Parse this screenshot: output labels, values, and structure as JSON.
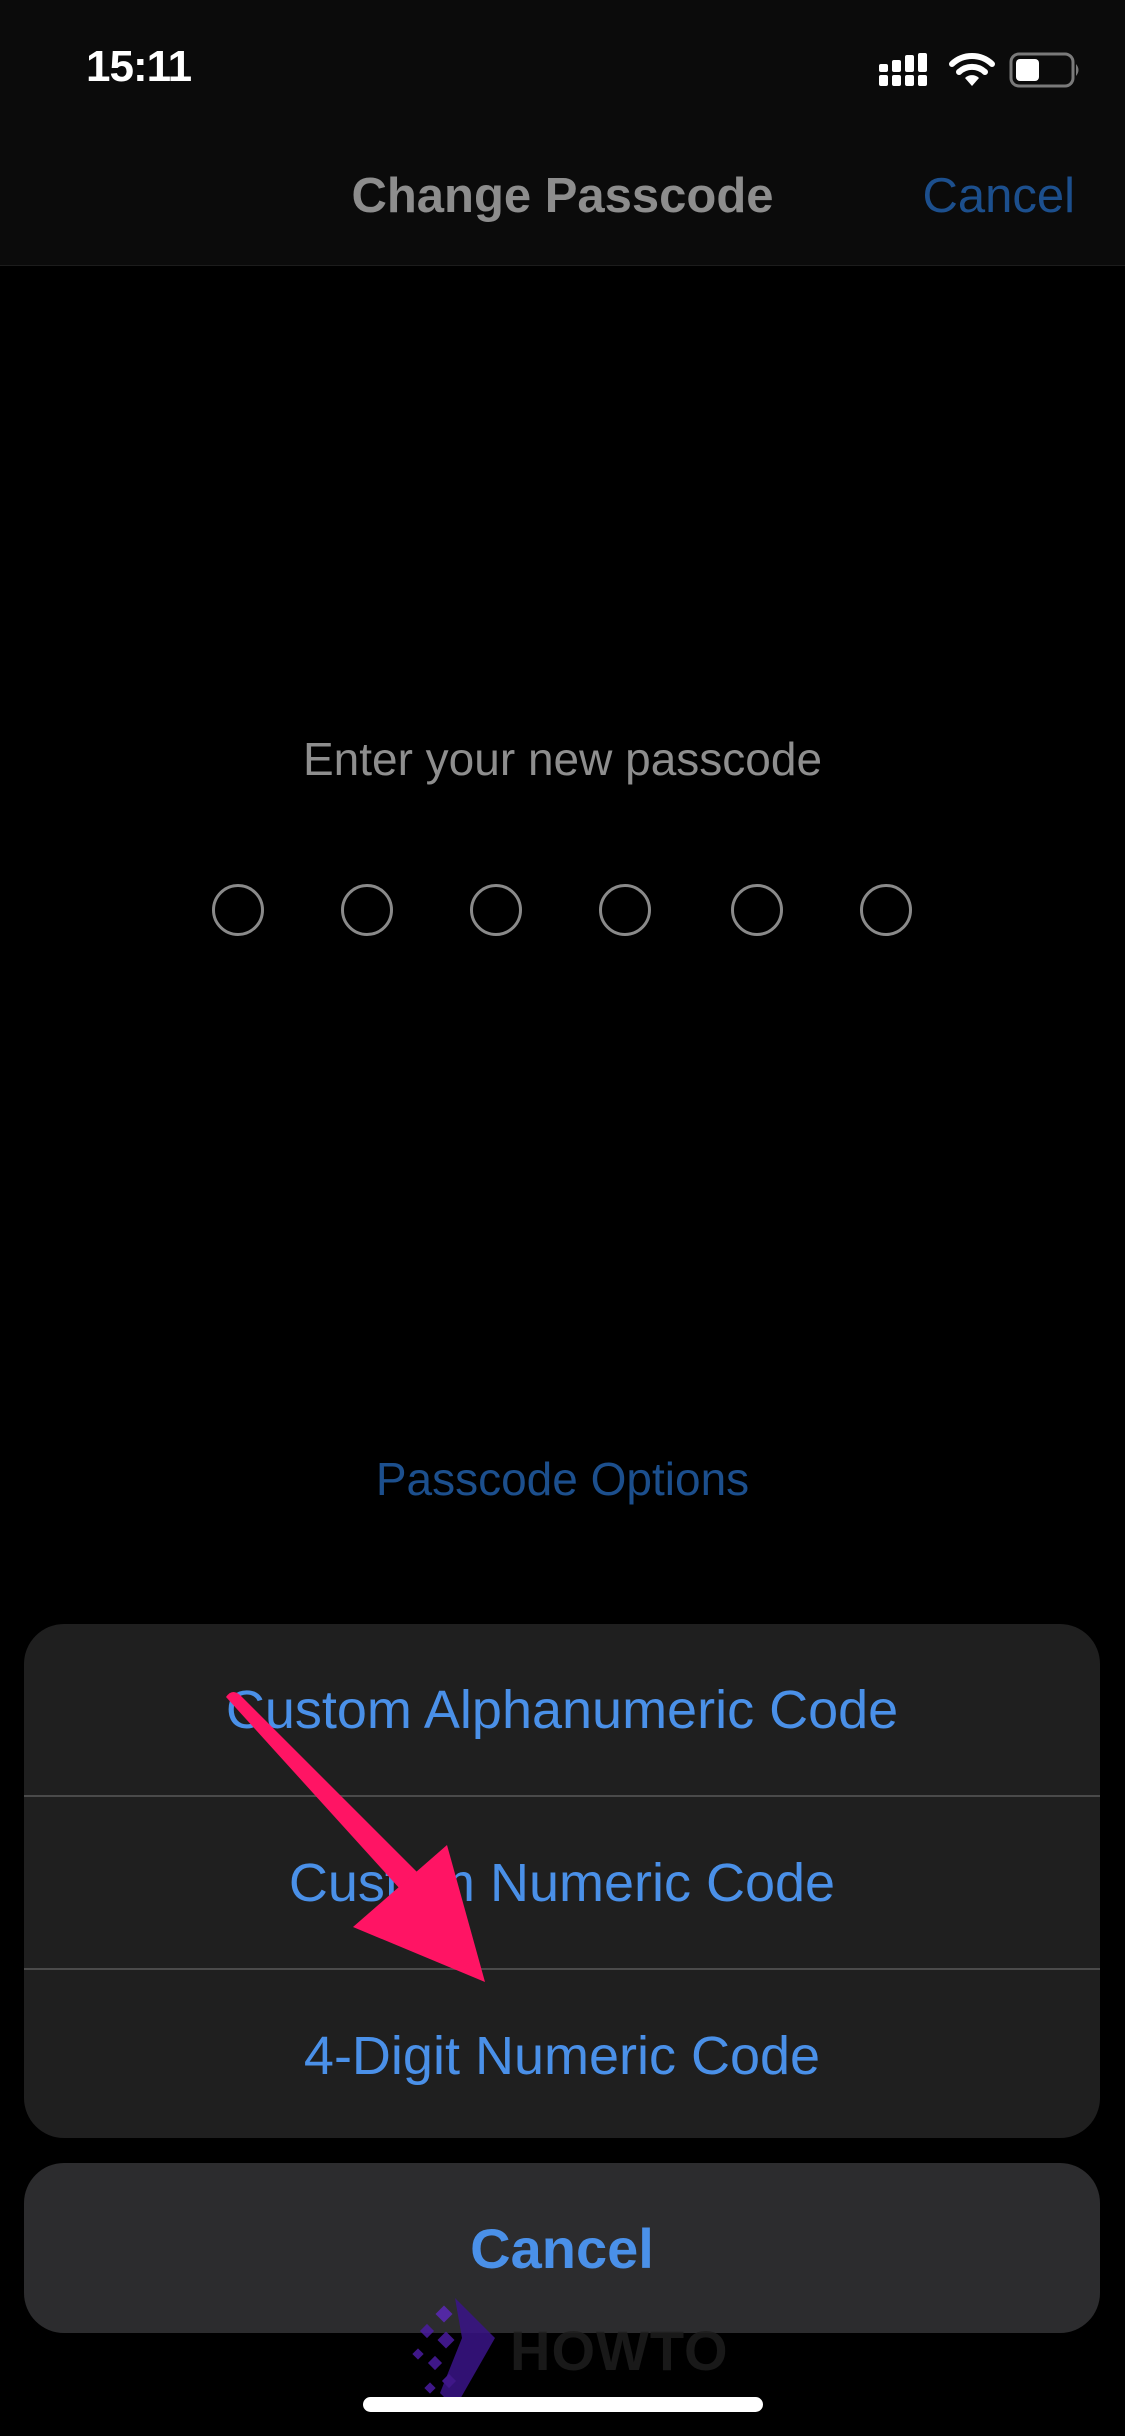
{
  "status_bar": {
    "time": "15:11",
    "icons": [
      "cellular-signal-icon",
      "wifi-icon",
      "battery-icon"
    ],
    "battery_level_percent": 45
  },
  "nav": {
    "title": "Change Passcode",
    "cancel_label": "Cancel"
  },
  "passcode_entry": {
    "prompt": "Enter your new passcode",
    "digit_count": 6,
    "digits_entered": 0
  },
  "options_link": "Passcode Options",
  "action_sheet": {
    "items": [
      {
        "label": "Custom Alphanumeric Code"
      },
      {
        "label": "Custom Numeric Code"
      },
      {
        "label": "4-Digit Numeric Code"
      }
    ],
    "cancel_label": "Cancel"
  },
  "annotation": {
    "type": "arrow",
    "points_to": "4-Digit Numeric Code",
    "color": "#ff1464"
  },
  "watermark": {
    "text": "HOWTO"
  },
  "colors": {
    "accent_blue": "#4a90e8",
    "dim_blue": "#1c4f8d",
    "sheet_bg": "#1f1f1f",
    "cancel_bg": "#2c2c2e",
    "text_gray": "#8e8e8e"
  }
}
